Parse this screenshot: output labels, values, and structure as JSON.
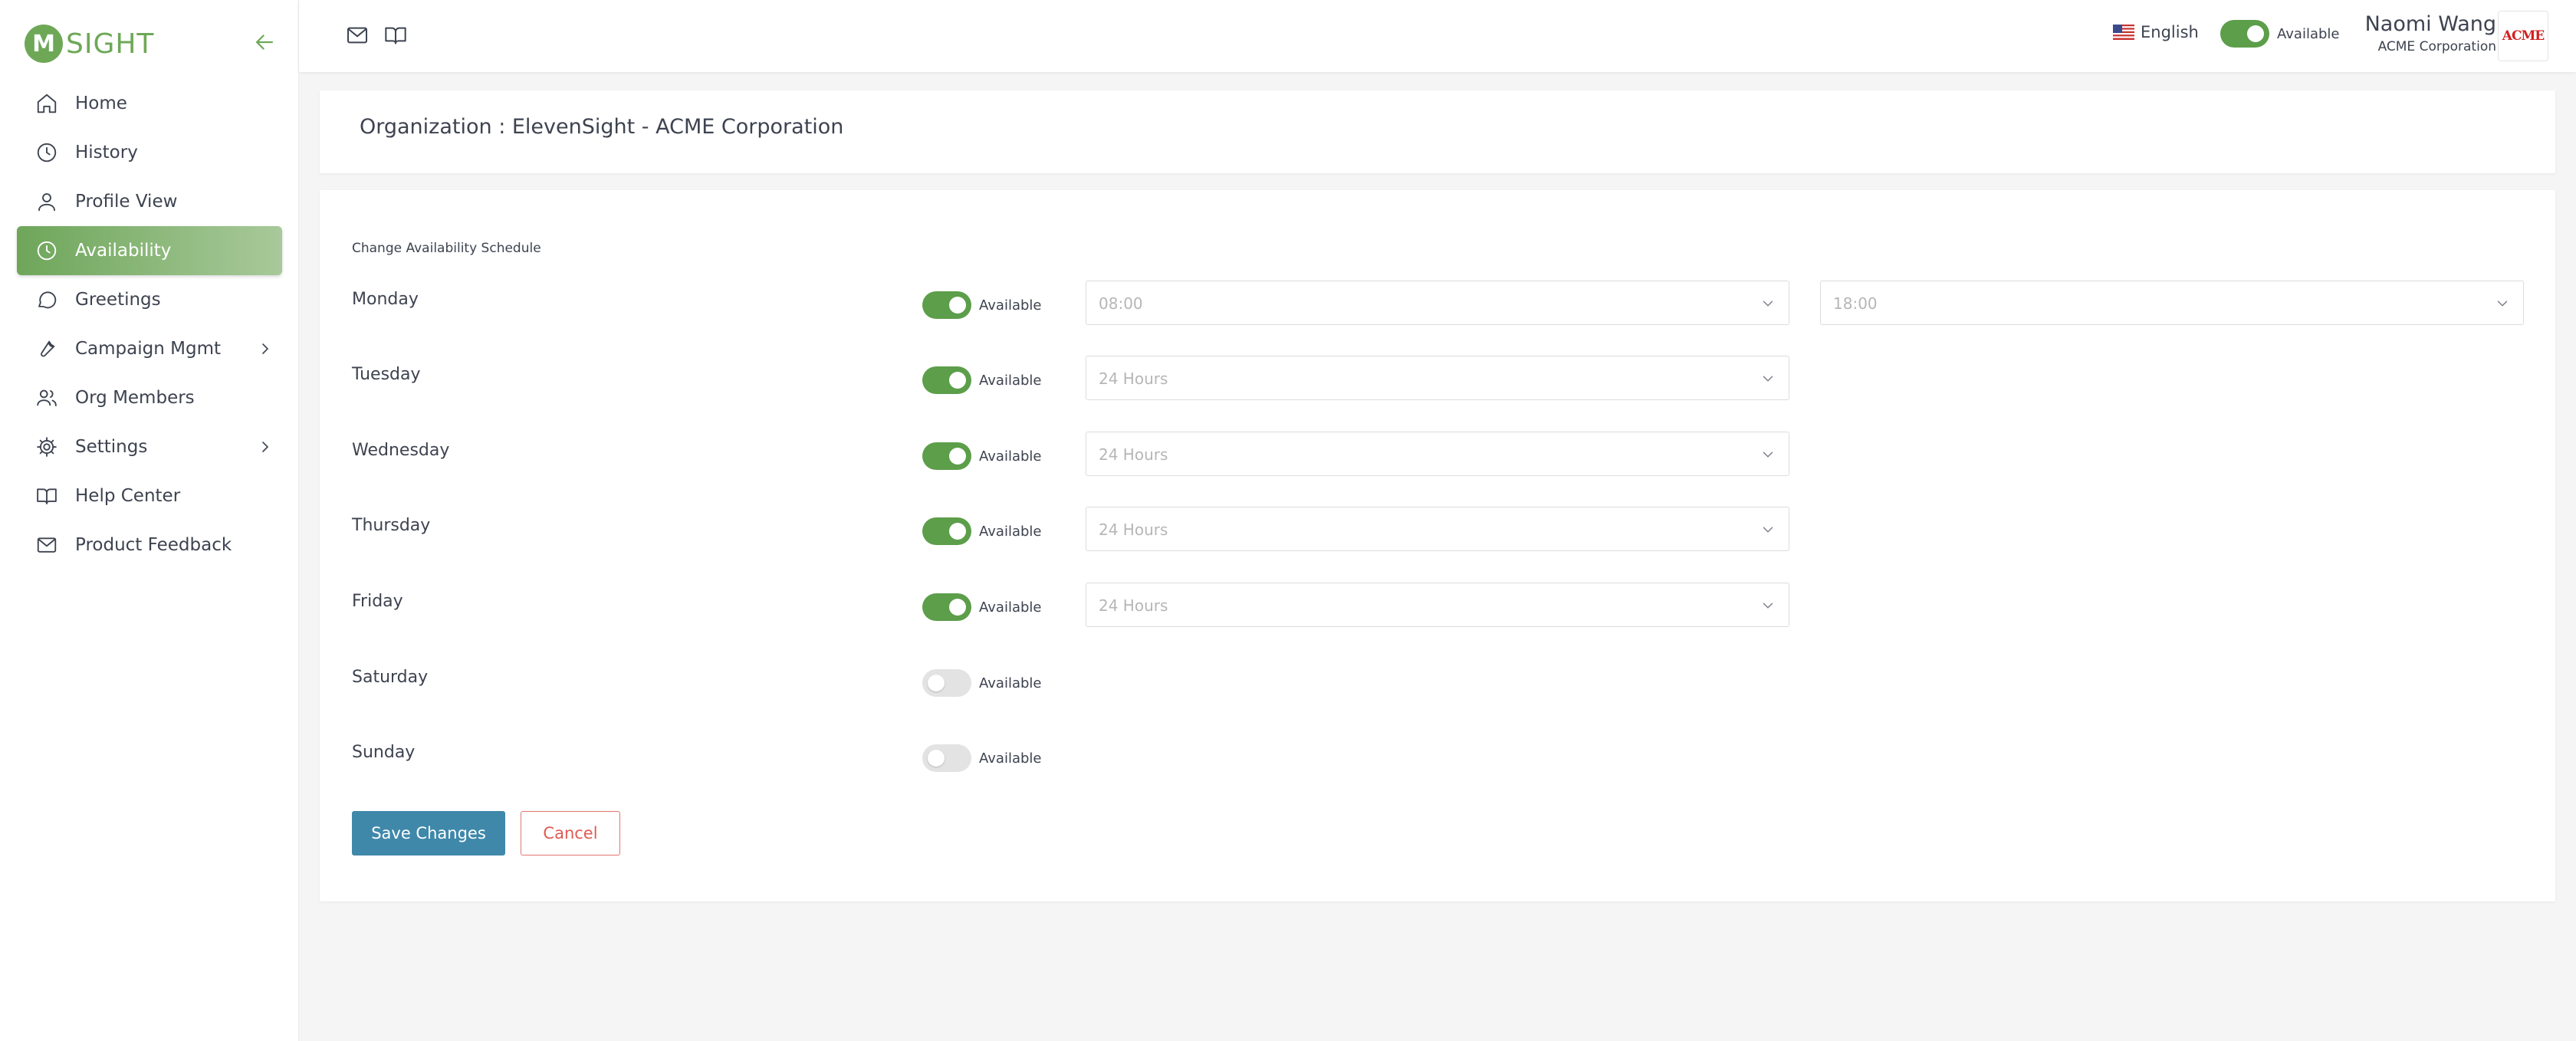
{
  "brand": {
    "logo_mark": "M",
    "logo_text": "SIGHT",
    "accent": "#6ea857"
  },
  "sidebar": {
    "collapse_icon": "arrow-left-icon",
    "items": [
      {
        "label": "Home",
        "icon": "home-icon"
      },
      {
        "label": "History",
        "icon": "clock-icon"
      },
      {
        "label": "Profile View",
        "icon": "user-icon"
      },
      {
        "label": "Availability",
        "icon": "clock-icon",
        "active": true
      },
      {
        "label": "Greetings",
        "icon": "chat-bubble-icon"
      },
      {
        "label": "Campaign Mgmt",
        "icon": "tool-icon",
        "has_submenu": true
      },
      {
        "label": "Org Members",
        "icon": "users-icon"
      },
      {
        "label": "Settings",
        "icon": "gear-icon",
        "has_submenu": true
      },
      {
        "label": "Help Center",
        "icon": "book-icon"
      },
      {
        "label": "Product Feedback",
        "icon": "mail-icon"
      }
    ]
  },
  "topbar": {
    "icons": [
      "mail-icon",
      "book-icon"
    ],
    "language": {
      "label": "English",
      "flag": "us-flag-icon"
    },
    "availability": {
      "label": "Available",
      "on": true
    },
    "user": {
      "name": "Naomi Wang",
      "org": "ACME Corporation",
      "avatar_text": "ACME"
    }
  },
  "organization": {
    "title": "Organization : ElevenSight - ACME Corporation"
  },
  "schedule": {
    "title": "Change Availability Schedule",
    "available_label": "Available",
    "days": [
      {
        "day": "Monday",
        "available": true,
        "start": "08:00",
        "end": "18:00"
      },
      {
        "day": "Tuesday",
        "available": true,
        "start": "24 Hours"
      },
      {
        "day": "Wednesday",
        "available": true,
        "start": "24 Hours"
      },
      {
        "day": "Thursday",
        "available": true,
        "start": "24 Hours"
      },
      {
        "day": "Friday",
        "available": true,
        "start": "24 Hours"
      },
      {
        "day": "Saturday",
        "available": false
      },
      {
        "day": "Sunday",
        "available": false
      }
    ],
    "save_label": "Save Changes",
    "cancel_label": "Cancel"
  },
  "colors": {
    "toggle_on": "#5c9e4a",
    "primary_button": "#3f88aa",
    "cancel": "#e05a52"
  }
}
